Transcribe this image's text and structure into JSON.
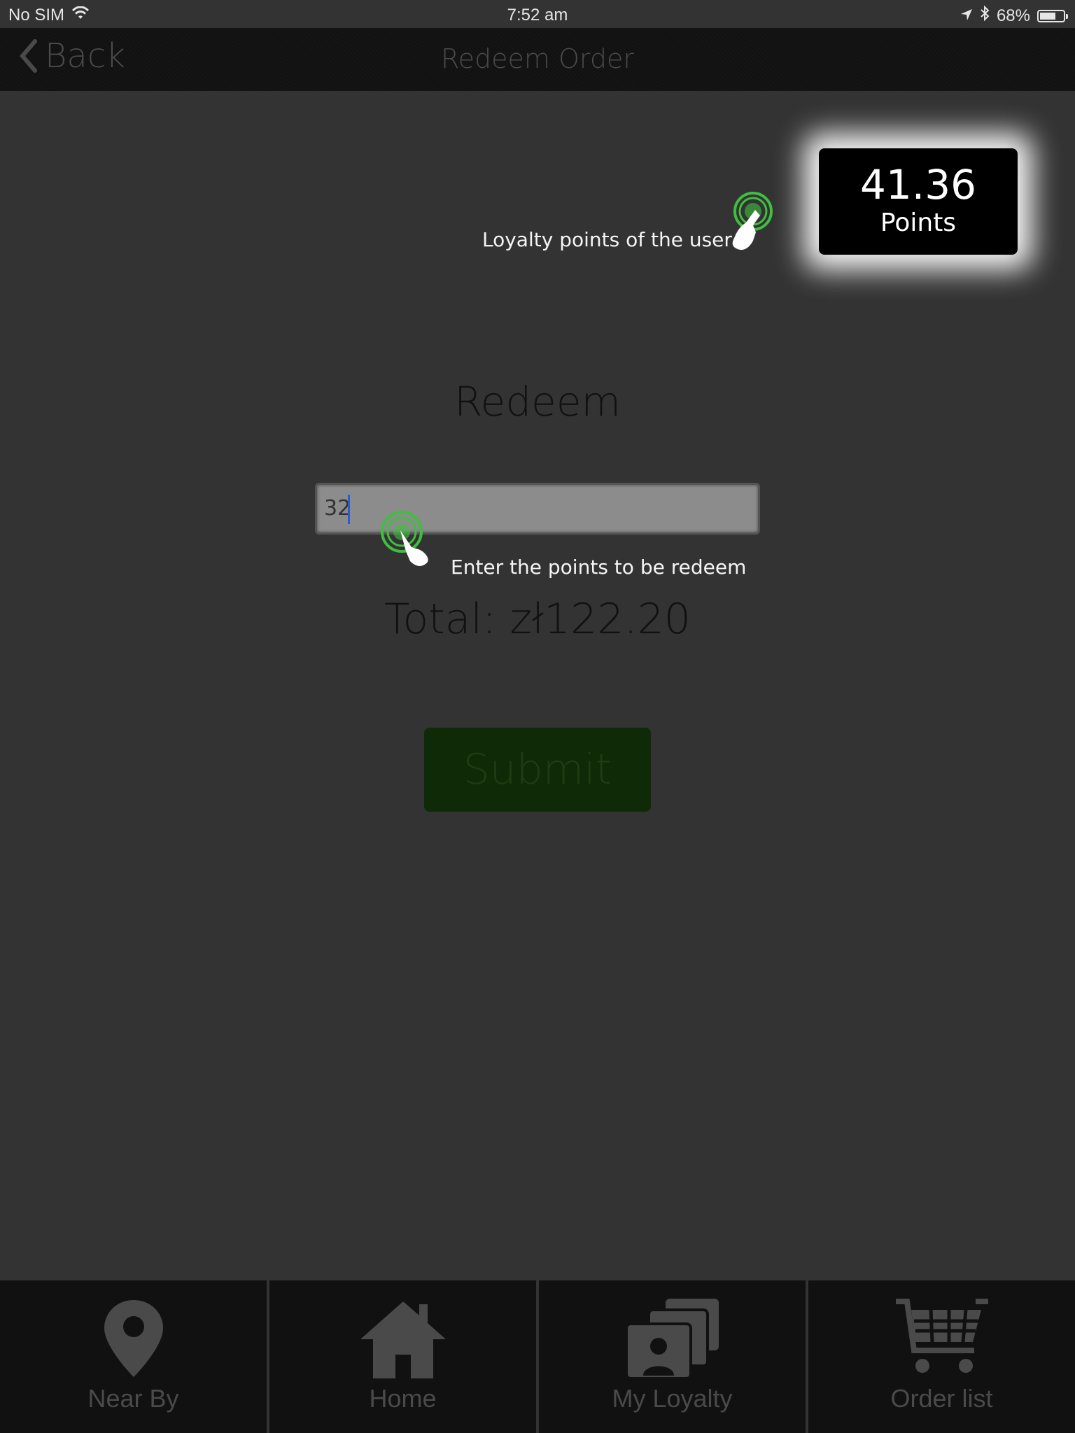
{
  "status_bar": {
    "carrier": "No SIM",
    "time": "7:52 am",
    "battery": "68%",
    "battery_level": 0.68
  },
  "nav": {
    "back_label": "Back",
    "title": "Redeem Order"
  },
  "points_card": {
    "value": "41.36",
    "label": "Points"
  },
  "hints": {
    "points_hint": "Loyalty points of the user",
    "input_hint": "Enter the points to be redeem"
  },
  "redeem": {
    "title": "Redeem",
    "input_value": "32",
    "total": "Total: zł122.20",
    "submit_label": "Submit"
  },
  "tabs": [
    {
      "label": "Near By",
      "icon": "map-pin-icon"
    },
    {
      "label": "Home",
      "icon": "home-icon"
    },
    {
      "label": "My Loyalty",
      "icon": "loyalty-cards-icon"
    },
    {
      "label": "Order list",
      "icon": "cart-icon"
    }
  ],
  "colors": {
    "background": "#333333",
    "bar": "#111111",
    "submit_bg": "#0e2a07",
    "tap_ring": "#3fbf3f",
    "caret": "#2a5bd7"
  }
}
